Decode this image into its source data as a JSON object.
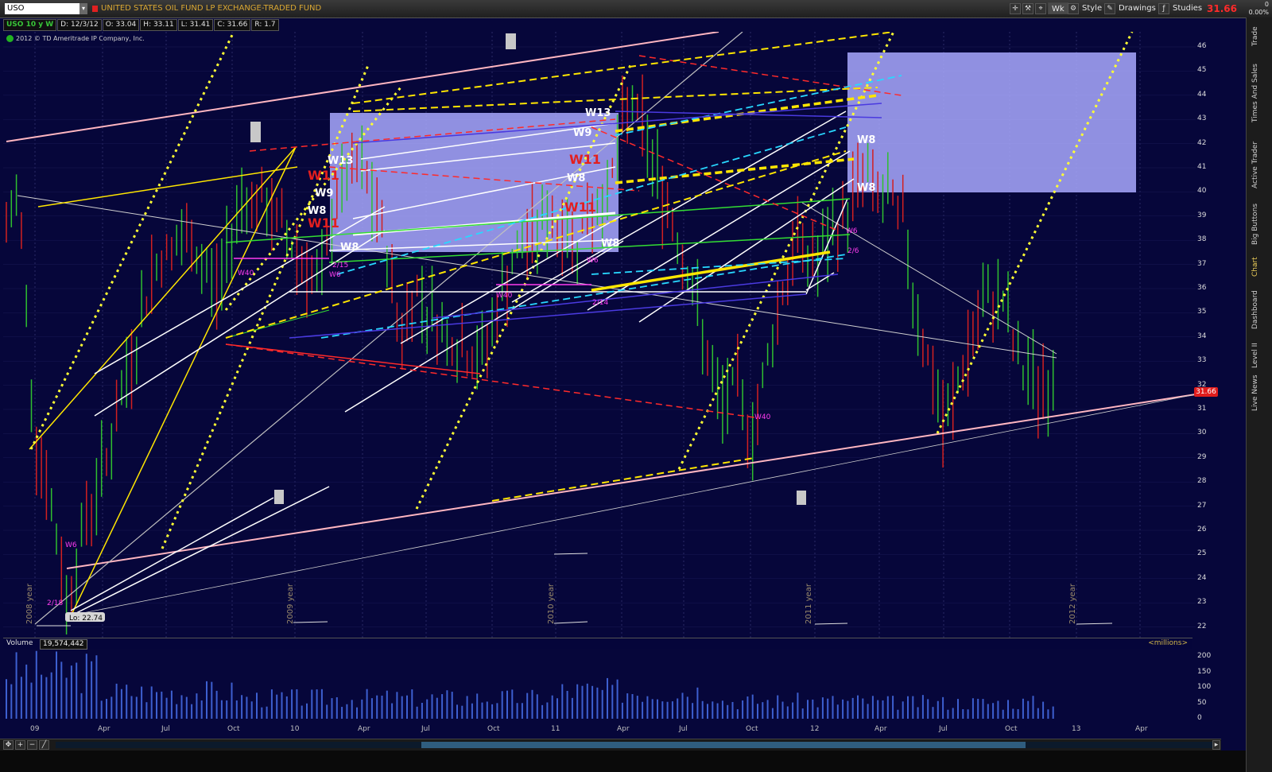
{
  "header": {
    "symbol": "USO",
    "title": "UNITED STATES OIL FUND LP EXCHANGE-TRADED FUND",
    "last_price": "31.66",
    "net_change": "0",
    "percent_change": "0.00%",
    "buttons": {
      "period": "Wk",
      "style": "Style",
      "drawings": "Drawings",
      "studies": "Studies"
    }
  },
  "info_bar": {
    "symbol_period": "USO 10 y W",
    "date": "D: 12/3/12",
    "open": "O: 33.04",
    "high": "H: 33.11",
    "low": "L: 31.41",
    "close": "C: 31.66",
    "range": "R: 1.7"
  },
  "copyright": "2012 © TD Ameritrade IP Company, Inc.",
  "side_tabs": [
    "Trade",
    "Times And Sales",
    "Active Trader",
    "Big Buttons",
    "Chart",
    "Dashboard",
    "Level II",
    "Live News"
  ],
  "price_axis": [
    "46",
    "45",
    "44",
    "43",
    "42",
    "41",
    "40",
    "39",
    "38",
    "37",
    "36",
    "35",
    "34",
    "33",
    "32",
    "31",
    "30",
    "29",
    "28",
    "27",
    "26",
    "25",
    "24",
    "23",
    "22"
  ],
  "last_price_tag": "31.66",
  "low_marker": "Lo: 22.74",
  "year_labels": [
    "2008 year",
    "2009 year",
    "2010 year",
    "2011 year",
    "2012 year"
  ],
  "annotations": {
    "w13_a": "W13",
    "w11_a": "W11",
    "w9_a": "W9",
    "w8_a": "W8",
    "w11_b": "W11",
    "w8_b": "W8",
    "w13_b": "W13",
    "w9_b": "W9",
    "w11_c": "W11",
    "w8_c": "W8",
    "w11_d": "W11",
    "w8_d": "W8",
    "w8_e": "W8",
    "w8_f": "W8",
    "m_w40_a": "W40",
    "m_w6_a": "W6",
    "m_215": "2/15",
    "m_w6_b": "W6",
    "m_w6_c": "W6",
    "m_w40_b": "W40",
    "m_214": "2/14",
    "m_w40_c": "W40",
    "m_w6_d": "W6",
    "m_26": "2/6",
    "m_218": "2/18",
    "m_w6_e": "W6"
  },
  "volume": {
    "label": "Volume",
    "value": "19,574,442",
    "units": "<millions>",
    "axis": [
      "200",
      "150",
      "100",
      "50",
      "0"
    ]
  },
  "x_axis": [
    "09",
    "Apr",
    "Jul",
    "Oct",
    "10",
    "Apr",
    "Jul",
    "Oct",
    "11",
    "Apr",
    "Jul",
    "Oct",
    "12",
    "Apr",
    "Jul",
    "Oct",
    "13",
    "Apr"
  ],
  "colors": {
    "background": "#06063a",
    "up_bar": "#2fbf2f",
    "down_bar": "#d22020",
    "volume_bar": "#3d5fd0",
    "highlight_box": "#a9a9ff",
    "accent_title": "#d9a733",
    "price_tag": "#e01c1c"
  }
}
